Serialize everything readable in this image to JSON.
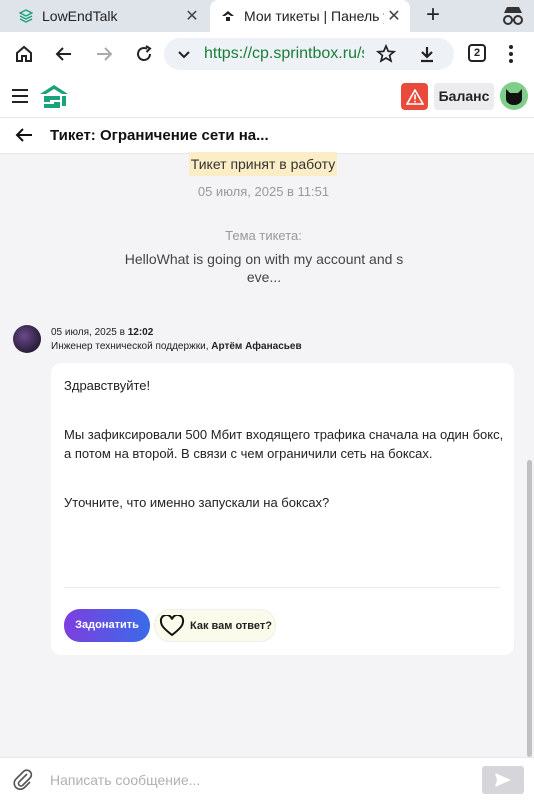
{
  "browser": {
    "tabs": [
      {
        "title": "LowEndTalk",
        "active": false,
        "icon": "stack-icon"
      },
      {
        "title": "Мои тикеты | Панель управ",
        "active": true,
        "icon": "sprintbox-icon"
      }
    ],
    "url": "https://cp.sprintbox.ru/supp",
    "tab_count": "2"
  },
  "header": {
    "balance_label": "Баланс",
    "alert_color": "#e84b3c",
    "brand_color": "#1aa37a"
  },
  "ticket": {
    "title": "Тикет: Ограничение сети на...",
    "status_badge": "Тикет принят в работу",
    "status_time": "05 июля, 2025 в 11:51",
    "subject_label": "Тема тикета:",
    "subject_text": "HelloWhat is going on with my account and s eve..."
  },
  "message": {
    "date": "05 июля, 2025 в",
    "time": "12:02",
    "author_role": "Инженер технической поддержки,",
    "author_name": "Артём Афанасьев",
    "greeting": "Здравствуйте!",
    "body": "Мы зафиксировали 500 Мбит входящего трафика сначала на один бокс, а потом на второй. В связи с чем ограничили сеть на боксах.",
    "question": "Уточните, что именно запускали на боксах?",
    "donate_label": "Задонатить",
    "rate_label": "Как вам ответ?"
  },
  "composer": {
    "placeholder": "Написать сообщение..."
  }
}
